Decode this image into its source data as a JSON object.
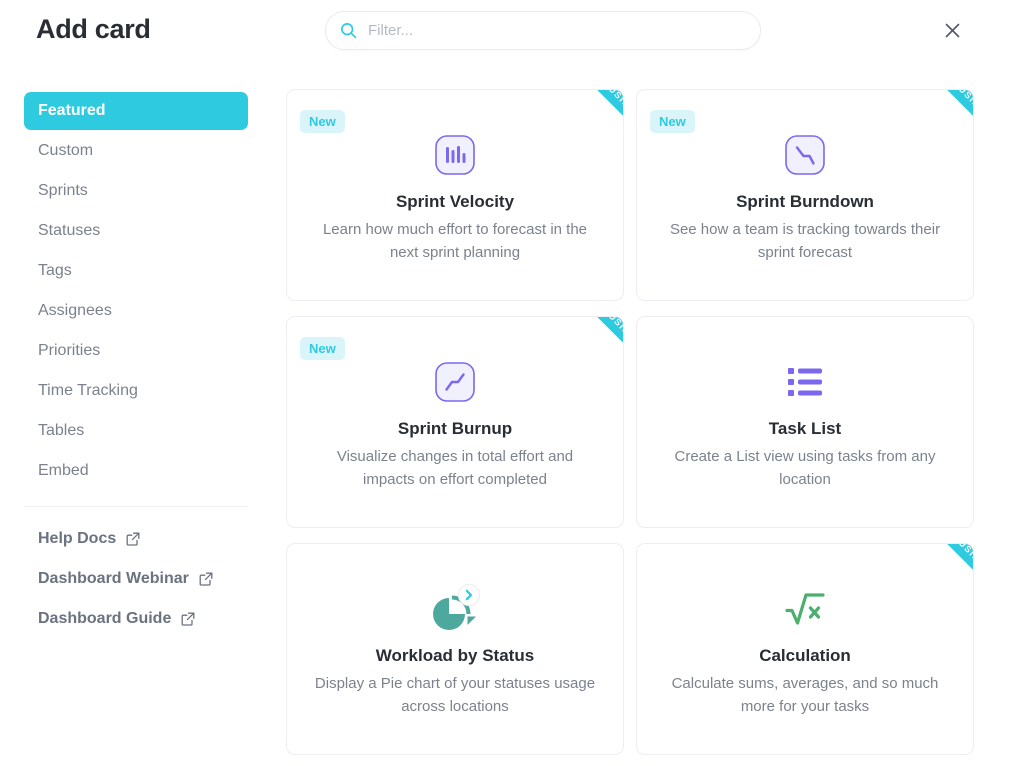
{
  "header": {
    "title": "Add card",
    "search": {
      "placeholder": "Filter...",
      "value": "",
      "icon": "search-icon"
    },
    "close_icon": "close-icon"
  },
  "sidebar": {
    "nav_items": [
      {
        "label": "Featured",
        "active": true
      },
      {
        "label": "Custom",
        "active": false
      },
      {
        "label": "Sprints",
        "active": false
      },
      {
        "label": "Statuses",
        "active": false
      },
      {
        "label": "Tags",
        "active": false
      },
      {
        "label": "Assignees",
        "active": false
      },
      {
        "label": "Priorities",
        "active": false
      },
      {
        "label": "Time Tracking",
        "active": false
      },
      {
        "label": "Tables",
        "active": false
      },
      {
        "label": "Embed",
        "active": false
      }
    ],
    "links": [
      {
        "label": "Help Docs",
        "icon": "external-link-icon"
      },
      {
        "label": "Dashboard Webinar",
        "icon": "external-link-icon"
      },
      {
        "label": "Dashboard Guide",
        "icon": "external-link-icon"
      }
    ]
  },
  "cards": [
    {
      "title": "Sprint Velocity",
      "description": "Learn how much effort to forecast in the next sprint planning",
      "badge": "New",
      "ribbon": "BUSINESS",
      "icon": "bar-chart-icon"
    },
    {
      "title": "Sprint Burndown",
      "description": "See how a team is tracking towards their sprint forecast",
      "badge": "New",
      "ribbon": "BUSINESS",
      "icon": "burndown-line-icon"
    },
    {
      "title": "Sprint Burnup",
      "description": "Visualize changes in total effort and impacts on effort completed",
      "badge": "New",
      "ribbon": "BUSINESS",
      "icon": "burnup-line-icon"
    },
    {
      "title": "Task List",
      "description": "Create a List view using tasks from any location",
      "badge": "",
      "ribbon": "",
      "icon": "list-icon"
    },
    {
      "title": "Workload by Status",
      "description": "Display a Pie chart of your statuses usage across locations",
      "badge": "",
      "ribbon": "",
      "icon": "pie-chart-icon"
    },
    {
      "title": "Calculation",
      "description": "Calculate sums, averages, and so much more for your tasks",
      "badge": "",
      "ribbon": "BUSINESS",
      "icon": "square-root-icon"
    }
  ],
  "colors": {
    "accent_cyan": "#2ecbe0",
    "badge_bg": "#daf5fa",
    "icon_purple": "#7b68ee",
    "icon_teal": "#4da89e",
    "icon_green": "#4caf6e",
    "text_dark": "#292d34",
    "text_muted": "#7c828d",
    "border": "#eceef2"
  }
}
